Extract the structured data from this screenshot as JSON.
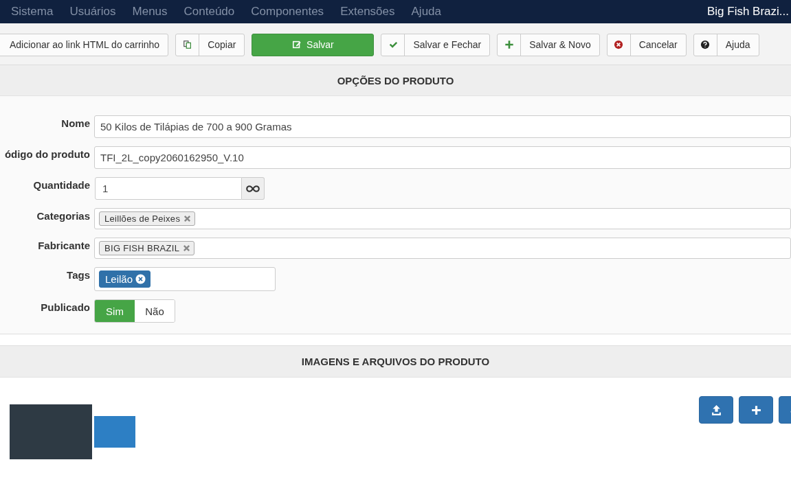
{
  "menu": [
    "Sistema",
    "Usuários",
    "Menus",
    "Conteúdo",
    "Componentes",
    "Extensões",
    "Ajuda"
  ],
  "site_title": "Big Fish Brazi...",
  "toolbar": [
    {
      "kind": "plain",
      "label": "Adicionar ao link HTML do carrinho"
    },
    {
      "kind": "copy",
      "label": "Copiar"
    },
    {
      "kind": "save",
      "label": "Salvar"
    },
    {
      "kind": "check",
      "label": "Salvar e Fechar"
    },
    {
      "kind": "plus",
      "label": "Salvar & Novo"
    },
    {
      "kind": "cancel",
      "label": "Cancelar"
    },
    {
      "kind": "help",
      "label": "Ajuda"
    }
  ],
  "product_options": {
    "title": "OPÇÕES DO PRODUTO",
    "fields": [
      {
        "kind": "text",
        "label": "Nome",
        "value": "50 Kilos de Tilápias de 700 a 900 Gramas"
      },
      {
        "kind": "text",
        "label": "ódigo do produto",
        "value": "TFI_2L_copy2060162950_V.10"
      },
      {
        "kind": "quantity",
        "label": "Quantidade",
        "value": "1"
      },
      {
        "kind": "chips",
        "label": "Categorias",
        "chips": [
          "Leillões de Peixes"
        ]
      },
      {
        "kind": "chips",
        "label": "Fabricante",
        "chips": [
          "BIG FISH BRAZIL"
        ]
      },
      {
        "kind": "tags",
        "label": "Tags",
        "chips": [
          "Leilão"
        ]
      },
      {
        "kind": "toggle",
        "label": "Publicado",
        "options": [
          {
            "label": "Sim",
            "selected": true
          },
          {
            "label": "Não",
            "selected": false
          }
        ]
      }
    ]
  },
  "images_section": {
    "title": "IMAGENS E ARQUIVOS DO PRODUTO"
  }
}
